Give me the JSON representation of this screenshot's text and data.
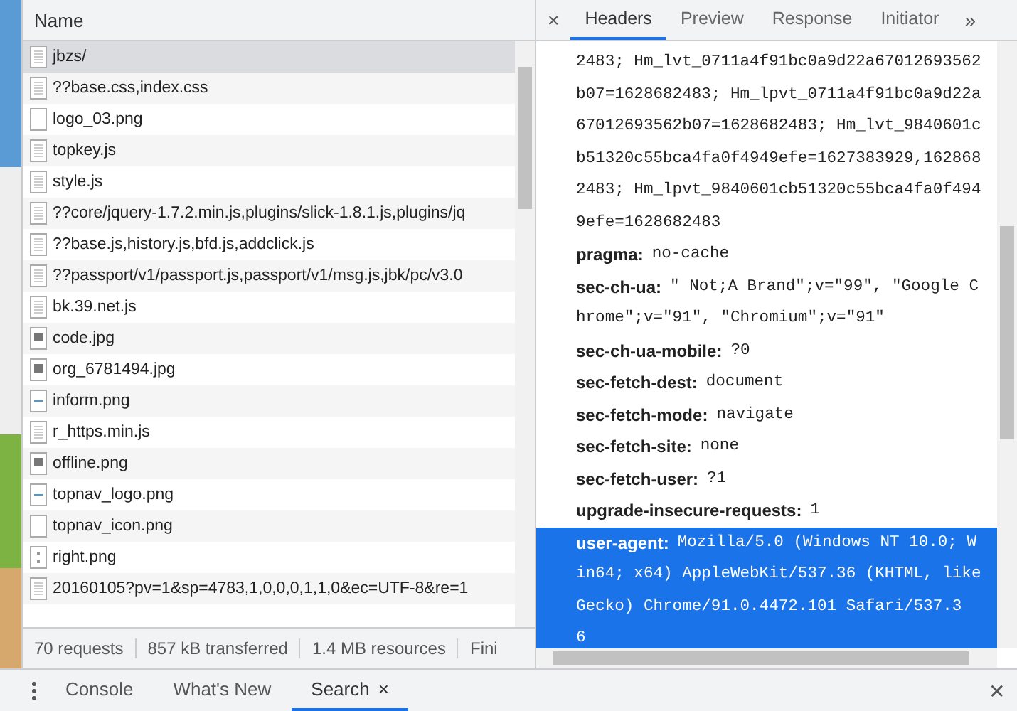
{
  "requests": {
    "column": "Name",
    "rows": [
      {
        "name": "jbzs/",
        "kind": "page",
        "selected": true
      },
      {
        "name": "??base.css,index.css",
        "kind": "page",
        "selected": false
      },
      {
        "name": "logo_03.png",
        "kind": "blank",
        "selected": false
      },
      {
        "name": "topkey.js",
        "kind": "page",
        "selected": false
      },
      {
        "name": "style.js",
        "kind": "page",
        "selected": false
      },
      {
        "name": "??core/jquery-1.7.2.min.js,plugins/slick-1.8.1.js,plugins/jq",
        "kind": "page",
        "selected": false
      },
      {
        "name": "??base.js,history.js,bfd.js,addclick.js",
        "kind": "page",
        "selected": false
      },
      {
        "name": "??passport/v1/passport.js,passport/v1/msg.js,jbk/pc/v3.0",
        "kind": "page",
        "selected": false
      },
      {
        "name": "bk.39.net.js",
        "kind": "page",
        "selected": false
      },
      {
        "name": "code.jpg",
        "kind": "image",
        "selected": false
      },
      {
        "name": "org_6781494.jpg",
        "kind": "image",
        "selected": false
      },
      {
        "name": "inform.png",
        "kind": "line",
        "selected": false
      },
      {
        "name": "r_https.min.js",
        "kind": "page",
        "selected": false
      },
      {
        "name": "offline.png",
        "kind": "image",
        "selected": false
      },
      {
        "name": "topnav_logo.png",
        "kind": "line",
        "selected": false
      },
      {
        "name": "topnav_icon.png",
        "kind": "blank",
        "selected": false
      },
      {
        "name": "right.png",
        "kind": "dots",
        "selected": false
      },
      {
        "name": "20160105?pv=1&sp=4783,1,0,0,0,1,1,0&ec=UTF-8&re=1",
        "kind": "page",
        "selected": false
      }
    ]
  },
  "status_bar": [
    "70 requests",
    "857 kB transferred",
    "1.4 MB resources",
    "Fini"
  ],
  "detail_tabs": [
    {
      "label": "Headers",
      "selected": true
    },
    {
      "label": "Preview",
      "selected": false
    },
    {
      "label": "Response",
      "selected": false
    },
    {
      "label": "Initiator",
      "selected": false
    }
  ],
  "close_glyph": "×",
  "more_glyph": "»",
  "headers": [
    {
      "lines": [
        "2483; Hm_lvt_0711a4f91bc0a9d22a67012693562",
        "b07=1628682483; Hm_lpvt_0711a4f91bc0a9d22a",
        "67012693562b07=1628682483; Hm_lvt_9840601c",
        "b51320c55bca4fa0f4949efe=1627383929,162868",
        "2483; Hm_lpvt_9840601cb51320c55bca4fa0f494",
        "9efe=1628682483"
      ],
      "selected": false
    },
    {
      "name": "pragma:",
      "lines": [
        "no-cache"
      ],
      "selected": false
    },
    {
      "name": "sec-ch-ua:",
      "lines": [
        "\" Not;A Brand\";v=\"99\", \"Google C",
        "hrome\";v=\"91\", \"Chromium\";v=\"91\""
      ],
      "selected": false
    },
    {
      "name": "sec-ch-ua-mobile:",
      "lines": [
        "?0"
      ],
      "selected": false
    },
    {
      "name": "sec-fetch-dest:",
      "lines": [
        "document"
      ],
      "selected": false
    },
    {
      "name": "sec-fetch-mode:",
      "lines": [
        "navigate"
      ],
      "selected": false
    },
    {
      "name": "sec-fetch-site:",
      "lines": [
        "none"
      ],
      "selected": false
    },
    {
      "name": "sec-fetch-user:",
      "lines": [
        "?1"
      ],
      "selected": false
    },
    {
      "name": "upgrade-insecure-requests:",
      "lines": [
        "1"
      ],
      "selected": false
    },
    {
      "name": "user-agent:",
      "lines": [
        "Mozilla/5.0 (Windows NT 10.0; W",
        "in64; x64) AppleWebKit/537.36 (KHTML, like",
        "Gecko) Chrome/91.0.4472.101 Safari/537.3",
        "6"
      ],
      "selected": true
    }
  ],
  "drawer_tabs": [
    {
      "label": "Console",
      "selected": false,
      "closable": false
    },
    {
      "label": "What's New",
      "selected": false,
      "closable": false
    },
    {
      "label": "Search",
      "selected": true,
      "closable": true
    }
  ],
  "drawer_close_glyph": "✕",
  "tab_close_glyph": "×"
}
